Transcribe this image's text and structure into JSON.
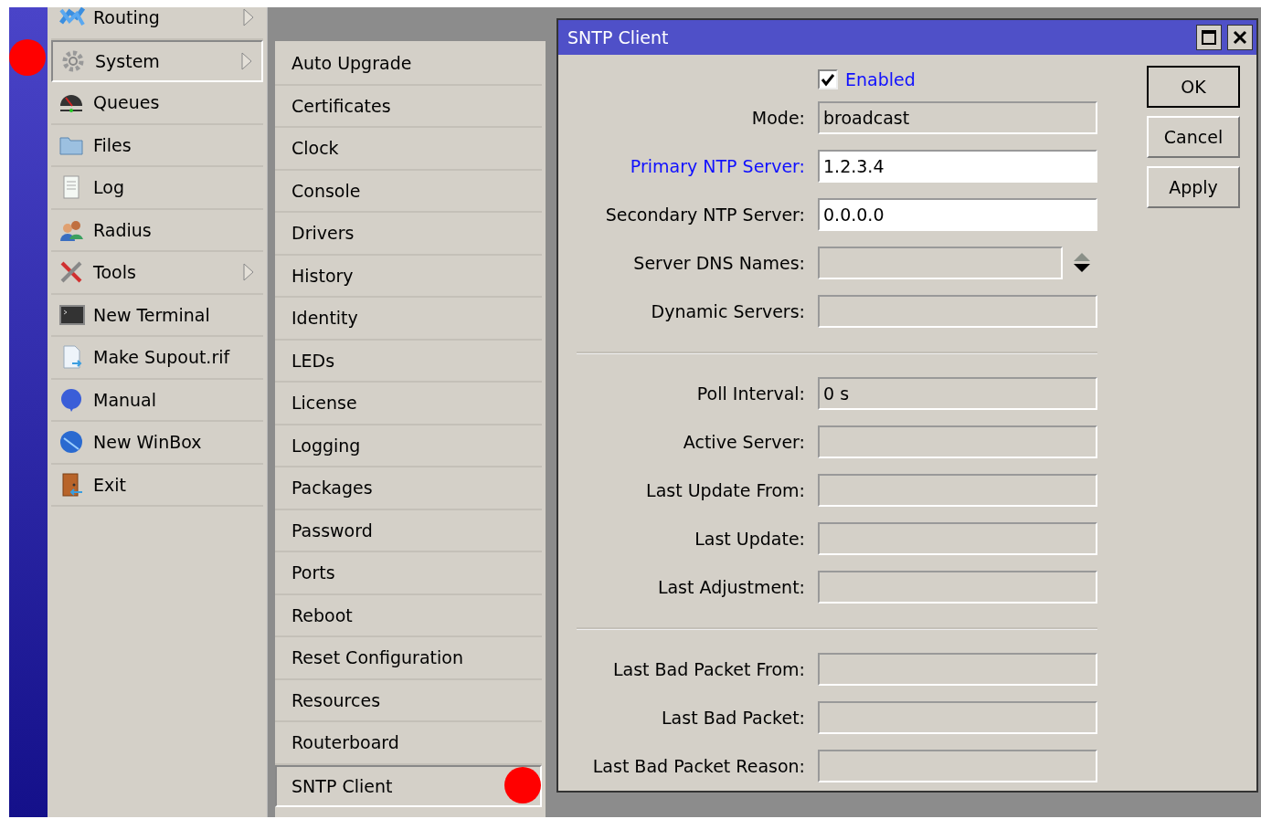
{
  "sidebar": {
    "items": [
      {
        "label": "Routing",
        "selected": false,
        "has_submenu": true
      },
      {
        "label": "System",
        "selected": true,
        "has_submenu": true
      },
      {
        "label": "Queues",
        "selected": false,
        "has_submenu": false
      },
      {
        "label": "Files",
        "selected": false,
        "has_submenu": false
      },
      {
        "label": "Log",
        "selected": false,
        "has_submenu": false
      },
      {
        "label": "Radius",
        "selected": false,
        "has_submenu": false
      },
      {
        "label": "Tools",
        "selected": false,
        "has_submenu": true
      },
      {
        "label": "New Terminal",
        "selected": false,
        "has_submenu": false
      },
      {
        "label": "Make Supout.rif",
        "selected": false,
        "has_submenu": false
      },
      {
        "label": "Manual",
        "selected": false,
        "has_submenu": false
      },
      {
        "label": "New WinBox",
        "selected": false,
        "has_submenu": false
      },
      {
        "label": "Exit",
        "selected": false,
        "has_submenu": false
      }
    ]
  },
  "submenu": {
    "items": [
      {
        "label": "Auto Upgrade",
        "selected": false
      },
      {
        "label": "Certificates",
        "selected": false
      },
      {
        "label": "Clock",
        "selected": false
      },
      {
        "label": "Console",
        "selected": false
      },
      {
        "label": "Drivers",
        "selected": false
      },
      {
        "label": "History",
        "selected": false
      },
      {
        "label": "Identity",
        "selected": false
      },
      {
        "label": "LEDs",
        "selected": false
      },
      {
        "label": "License",
        "selected": false
      },
      {
        "label": "Logging",
        "selected": false
      },
      {
        "label": "Packages",
        "selected": false
      },
      {
        "label": "Password",
        "selected": false
      },
      {
        "label": "Ports",
        "selected": false
      },
      {
        "label": "Reboot",
        "selected": false
      },
      {
        "label": "Reset Configuration",
        "selected": false
      },
      {
        "label": "Resources",
        "selected": false
      },
      {
        "label": "Routerboard",
        "selected": false
      },
      {
        "label": "SNTP Client",
        "selected": true
      }
    ]
  },
  "dialog": {
    "title": "SNTP Client",
    "enabled": {
      "label": "Enabled",
      "checked": true,
      "changed": true
    },
    "groups": [
      [
        {
          "label": "Mode:",
          "value": "broadcast",
          "editable": false,
          "changed": false,
          "kind": "text"
        },
        {
          "label": "Primary NTP Server:",
          "value": "1.2.3.4",
          "editable": true,
          "changed": true,
          "kind": "text"
        },
        {
          "label": "Secondary NTP Server:",
          "value": "0.0.0.0",
          "editable": true,
          "changed": false,
          "kind": "text"
        },
        {
          "label": "Server DNS Names:",
          "editable": false,
          "changed": false,
          "kind": "list"
        },
        {
          "label": "Dynamic Servers:",
          "editable": false,
          "changed": false,
          "kind": "text"
        }
      ],
      [
        {
          "label": "Poll Interval:",
          "value": "0 s",
          "editable": false,
          "changed": false,
          "kind": "text"
        },
        {
          "label": "Active Server:",
          "editable": false,
          "changed": false,
          "kind": "text"
        },
        {
          "label": "Last Update From:",
          "editable": false,
          "changed": false,
          "kind": "text"
        },
        {
          "label": "Last Update:",
          "editable": false,
          "changed": false,
          "kind": "text"
        },
        {
          "label": "Last Adjustment:",
          "editable": false,
          "changed": false,
          "kind": "text"
        }
      ],
      [
        {
          "label": "Last Bad Packet From:",
          "editable": false,
          "changed": false,
          "kind": "text"
        },
        {
          "label": "Last Bad Packet:",
          "editable": false,
          "changed": false,
          "kind": "text"
        },
        {
          "label": "Last Bad Packet Reason:",
          "editable": false,
          "changed": false,
          "kind": "text"
        }
      ]
    ],
    "buttons": [
      {
        "label": "OK",
        "default": true
      },
      {
        "label": "Cancel",
        "default": false
      },
      {
        "label": "Apply",
        "default": false
      }
    ]
  }
}
